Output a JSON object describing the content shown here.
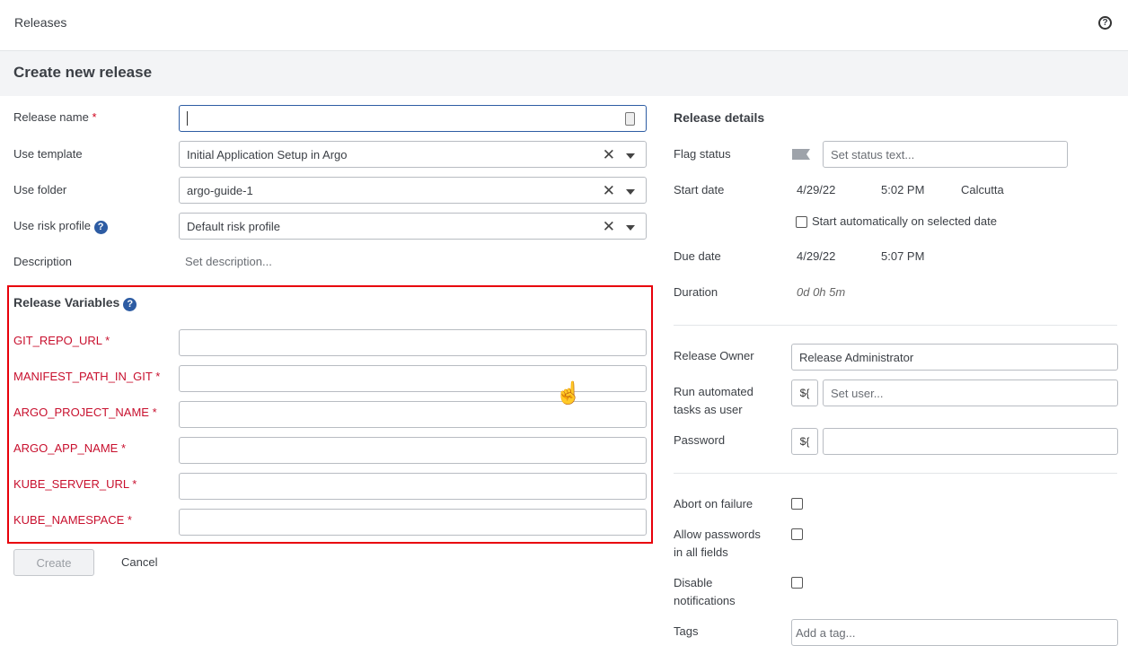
{
  "header": {
    "title": "Releases",
    "help_icon": "question-circle-icon"
  },
  "page_title": "Create new release",
  "form": {
    "release_name": {
      "label": "Release name",
      "required": "*",
      "value": ""
    },
    "template": {
      "label": "Use template",
      "value": "Initial Application Setup in Argo"
    },
    "folder": {
      "label": "Use folder",
      "value": "argo-guide-1"
    },
    "risk_profile": {
      "label": "Use risk profile",
      "value": "Default risk profile"
    },
    "description": {
      "label": "Description",
      "placeholder": "Set description..."
    }
  },
  "variables": {
    "title": "Release Variables",
    "items": [
      {
        "name": "GIT_REPO_URL",
        "required": "*",
        "value": ""
      },
      {
        "name": "MANIFEST_PATH_IN_GIT",
        "required": "*",
        "value": ""
      },
      {
        "name": "ARGO_PROJECT_NAME",
        "required": "*",
        "value": ""
      },
      {
        "name": "ARGO_APP_NAME",
        "required": "*",
        "value": ""
      },
      {
        "name": "KUBE_SERVER_URL",
        "required": "*",
        "value": ""
      },
      {
        "name": "KUBE_NAMESPACE",
        "required": "*",
        "value": ""
      }
    ]
  },
  "actions": {
    "create": "Create",
    "cancel": "Cancel"
  },
  "details": {
    "title": "Release details",
    "flag_status": {
      "label": "Flag status",
      "placeholder": "Set status text..."
    },
    "start_date": {
      "label": "Start date",
      "date": "4/29/22",
      "time": "5:02 PM",
      "timezone": "Calcutta"
    },
    "auto_start": {
      "label": "Start automatically on selected date",
      "checked": false
    },
    "due_date": {
      "label": "Due date",
      "date": "4/29/22",
      "time": "5:07 PM"
    },
    "duration": {
      "label": "Duration",
      "value": "0d 0h 5m"
    },
    "owner": {
      "label": "Release Owner",
      "value": "Release Administrator"
    },
    "run_as": {
      "label1": "Run automated",
      "label2": "tasks as user",
      "var_button": "${",
      "placeholder": "Set user..."
    },
    "password": {
      "label": "Password",
      "var_button": "${",
      "value": ""
    },
    "abort": {
      "label": "Abort on failure",
      "checked": false
    },
    "allow_passwords": {
      "label1": "Allow passwords",
      "label2": "in all fields",
      "checked": false
    },
    "disable_notifications": {
      "label1": "Disable",
      "label2": "notifications",
      "checked": false
    },
    "tags": {
      "label": "Tags",
      "placeholder": "Add a tag..."
    }
  },
  "colors": {
    "accent": "#2d5ca3",
    "required": "#d0021b",
    "highlight_box": "#e8000b"
  }
}
